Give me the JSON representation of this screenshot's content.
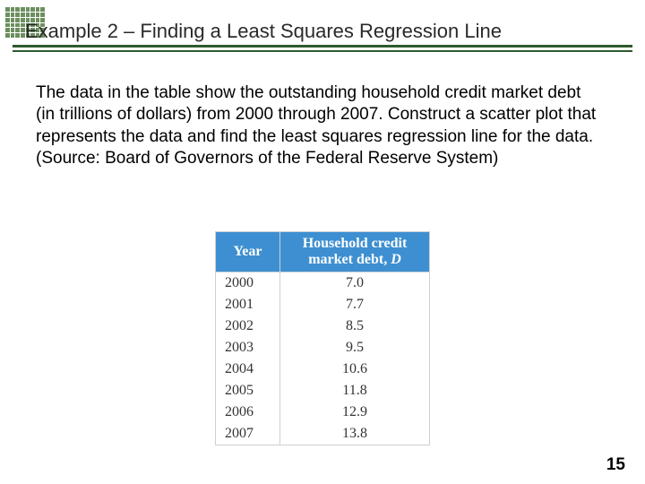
{
  "header": {
    "title": "Example 2 – Finding a Least Squares Regression Line"
  },
  "body": {
    "paragraph": "The data in the table show the outstanding household credit market debt (in trillions of dollars) from 2000 through 2007. Construct a scatter plot that represents the data and find the least squares regression line for the data. (Source: Board of Governors of the Federal Reserve System)"
  },
  "chart_data": {
    "type": "table",
    "title": "",
    "columns": [
      "Year",
      "Household credit market debt, D"
    ],
    "rows": [
      {
        "year": "2000",
        "debt": "7.0"
      },
      {
        "year": "2001",
        "debt": "7.7"
      },
      {
        "year": "2002",
        "debt": "8.5"
      },
      {
        "year": "2003",
        "debt": "9.5"
      },
      {
        "year": "2004",
        "debt": "10.6"
      },
      {
        "year": "2005",
        "debt": "11.8"
      },
      {
        "year": "2006",
        "debt": "12.9"
      },
      {
        "year": "2007",
        "debt": "13.8"
      }
    ]
  },
  "footer": {
    "page_number": "15"
  },
  "colors": {
    "rule": "#2f5a2d",
    "table_header_bg": "#3d8fd1"
  }
}
